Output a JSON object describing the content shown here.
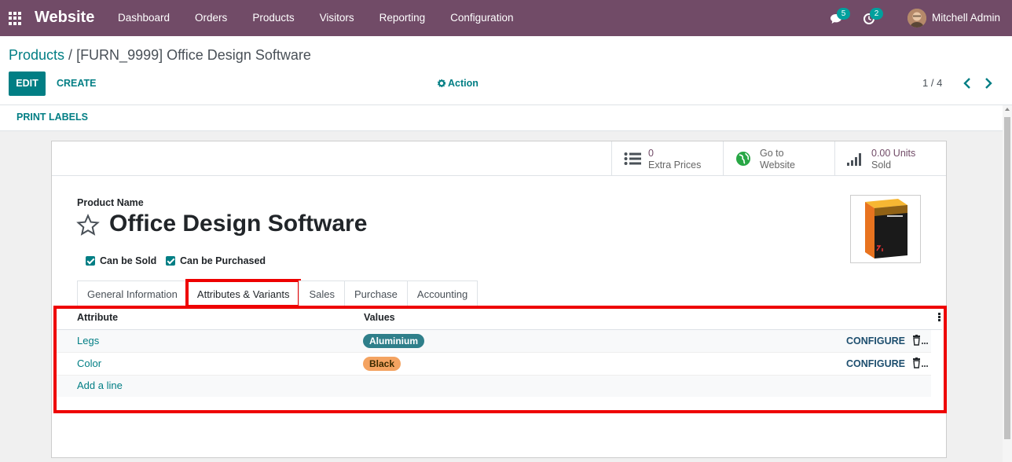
{
  "navbar": {
    "brand": "Website",
    "menu": [
      "Dashboard",
      "Orders",
      "Products",
      "Visitors",
      "Reporting",
      "Configuration"
    ],
    "chat_badge": "5",
    "activity_badge": "2",
    "user_name": "Mitchell Admin"
  },
  "breadcrumb": {
    "parent": "Products",
    "separator": " / ",
    "current": "[FURN_9999] Office Design Software"
  },
  "toolbar": {
    "edit_label": "EDIT",
    "create_label": "CREATE",
    "action_label": "Action",
    "pager": "1 / 4",
    "print_labels": "PRINT LABELS"
  },
  "stat_buttons": [
    {
      "value": "0",
      "label": "Extra Prices",
      "icon": "list-icon"
    },
    {
      "value": "Go to",
      "label": "Website",
      "icon": "globe-icon"
    },
    {
      "value": "0.00 Units",
      "label": "Sold",
      "icon": "bar-chart-icon"
    }
  ],
  "form": {
    "product_name_label": "Product Name",
    "product_name": "Office Design Software",
    "can_be_sold": "Can be Sold",
    "can_be_purchased": "Can be Purchased"
  },
  "tabs": [
    "General Information",
    "Attributes & Variants",
    "Sales",
    "Purchase",
    "Accounting"
  ],
  "active_tab": "Attributes & Variants",
  "table": {
    "headers": {
      "attribute": "Attribute",
      "values": "Values"
    },
    "rows": [
      {
        "attribute": "Legs",
        "value": "Aluminium",
        "configure": "CONFIGURE"
      },
      {
        "attribute": "Color",
        "value": "Black",
        "configure": "CONFIGURE"
      }
    ],
    "add_line": "Add a line"
  },
  "colors": {
    "navbar": "#714b67",
    "accent": "#017e84",
    "highlight": "#e00000"
  }
}
